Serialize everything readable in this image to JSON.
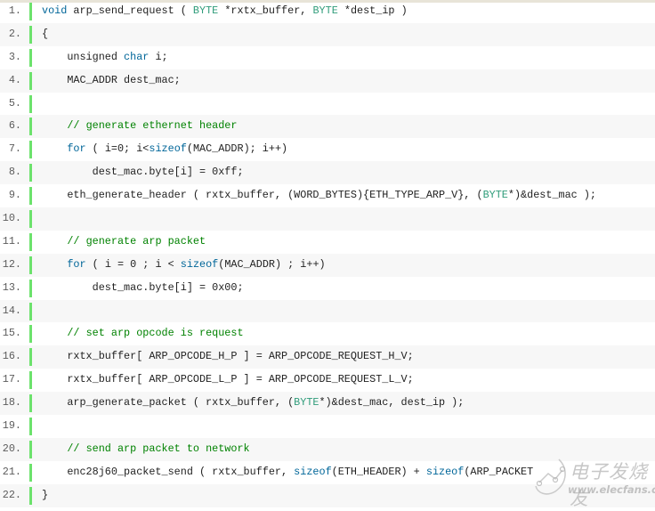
{
  "code": {
    "gutter_color": "#6ce26c",
    "colors": {
      "keyword": "#006699",
      "type": "#2f9c7a",
      "comment": "#008200",
      "text": "#222222",
      "line_number": "#5c5c5c"
    },
    "lines": [
      {
        "n": "1.",
        "tokens": [
          [
            "kw",
            "void"
          ],
          [
            "t",
            " arp_send_request ( "
          ],
          [
            "ty",
            "BYTE"
          ],
          [
            "t",
            " *rxtx_buffer, "
          ],
          [
            "ty",
            "BYTE"
          ],
          [
            "t",
            " *dest_ip )"
          ]
        ]
      },
      {
        "n": "2.",
        "tokens": [
          [
            "t",
            "{"
          ]
        ]
      },
      {
        "n": "3.",
        "tokens": [
          [
            "t",
            "    unsigned "
          ],
          [
            "kw",
            "char"
          ],
          [
            "t",
            " i;"
          ]
        ]
      },
      {
        "n": "4.",
        "tokens": [
          [
            "t",
            "    MAC_ADDR dest_mac;"
          ]
        ]
      },
      {
        "n": "5.",
        "tokens": []
      },
      {
        "n": "6.",
        "tokens": [
          [
            "t",
            "    "
          ],
          [
            "cm",
            "// generate ethernet header"
          ]
        ]
      },
      {
        "n": "7.",
        "tokens": [
          [
            "t",
            "    "
          ],
          [
            "kw",
            "for"
          ],
          [
            "t",
            " ( i=0; i<"
          ],
          [
            "kw",
            "sizeof"
          ],
          [
            "t",
            "(MAC_ADDR); i++)"
          ]
        ]
      },
      {
        "n": "8.",
        "tokens": [
          [
            "t",
            "        dest_mac.byte[i] = 0xff;"
          ]
        ]
      },
      {
        "n": "9.",
        "tokens": [
          [
            "t",
            "    eth_generate_header ( rxtx_buffer, (WORD_BYTES){ETH_TYPE_ARP_V}, ("
          ],
          [
            "ty",
            "BYTE"
          ],
          [
            "t",
            "*)&dest_mac );"
          ]
        ]
      },
      {
        "n": "10.",
        "tokens": []
      },
      {
        "n": "11.",
        "tokens": [
          [
            "t",
            "    "
          ],
          [
            "cm",
            "// generate arp packet"
          ]
        ]
      },
      {
        "n": "12.",
        "tokens": [
          [
            "t",
            "    "
          ],
          [
            "kw",
            "for"
          ],
          [
            "t",
            " ( i = 0 ; i < "
          ],
          [
            "kw",
            "sizeof"
          ],
          [
            "t",
            "(MAC_ADDR) ; i++)"
          ]
        ]
      },
      {
        "n": "13.",
        "tokens": [
          [
            "t",
            "        dest_mac.byte[i] = 0x00;"
          ]
        ]
      },
      {
        "n": "14.",
        "tokens": []
      },
      {
        "n": "15.",
        "tokens": [
          [
            "t",
            "    "
          ],
          [
            "cm",
            "// set arp opcode is request"
          ]
        ]
      },
      {
        "n": "16.",
        "tokens": [
          [
            "t",
            "    rxtx_buffer[ ARP_OPCODE_H_P ] = ARP_OPCODE_REQUEST_H_V;"
          ]
        ]
      },
      {
        "n": "17.",
        "tokens": [
          [
            "t",
            "    rxtx_buffer[ ARP_OPCODE_L_P ] = ARP_OPCODE_REQUEST_L_V;"
          ]
        ]
      },
      {
        "n": "18.",
        "tokens": [
          [
            "t",
            "    arp_generate_packet ( rxtx_buffer, ("
          ],
          [
            "ty",
            "BYTE"
          ],
          [
            "t",
            "*)&dest_mac, dest_ip );"
          ]
        ]
      },
      {
        "n": "19.",
        "tokens": []
      },
      {
        "n": "20.",
        "tokens": [
          [
            "t",
            "    "
          ],
          [
            "cm",
            "// send arp packet to network"
          ]
        ]
      },
      {
        "n": "21.",
        "tokens": [
          [
            "t",
            "    enc28j60_packet_send ( rxtx_buffer, "
          ],
          [
            "kw",
            "sizeof"
          ],
          [
            "t",
            "(ETH_HEADER) + "
          ],
          [
            "kw",
            "sizeof"
          ],
          [
            "t",
            "(ARP_PACKET"
          ]
        ]
      },
      {
        "n": "22.",
        "tokens": [
          [
            "t",
            "}"
          ]
        ]
      }
    ]
  },
  "watermark": {
    "name_cn": "电子发烧友",
    "url": "www.elecfans.com",
    "icon": "circuit-logo-icon"
  }
}
